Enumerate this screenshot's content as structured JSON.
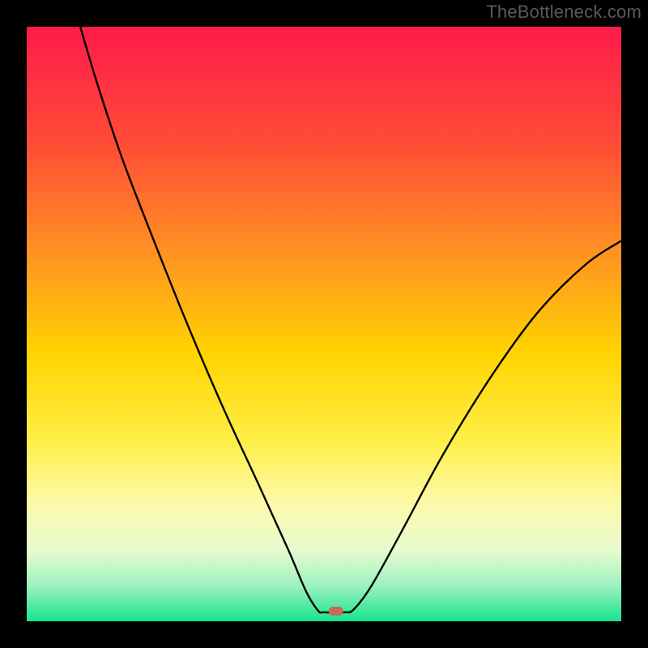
{
  "watermark": "TheBottleneck.com",
  "chart_data": {
    "type": "line",
    "title": "",
    "xlabel": "",
    "ylabel": "",
    "xlim": [
      0,
      100
    ],
    "ylim": [
      0,
      100
    ],
    "background_gradient": {
      "stops": [
        {
          "offset": 0,
          "color": "#ff1a4b"
        },
        {
          "offset": 20,
          "color": "#ff4d36"
        },
        {
          "offset": 40,
          "color": "#ff9a1f"
        },
        {
          "offset": 55,
          "color": "#ffd400"
        },
        {
          "offset": 70,
          "color": "#ffef4a"
        },
        {
          "offset": 80,
          "color": "#fdf9a8"
        },
        {
          "offset": 88,
          "color": "#e8fbcf"
        },
        {
          "offset": 94,
          "color": "#9df2c0"
        },
        {
          "offset": 100,
          "color": "#17e38e"
        }
      ]
    },
    "series": [
      {
        "name": "bottleneck-curve",
        "color": "#000000",
        "points": [
          {
            "x": 9.0,
            "y": 100.0
          },
          {
            "x": 12.0,
            "y": 90.0
          },
          {
            "x": 16.0,
            "y": 78.0
          },
          {
            "x": 21.0,
            "y": 65.0
          },
          {
            "x": 27.0,
            "y": 50.0
          },
          {
            "x": 33.0,
            "y": 36.0
          },
          {
            "x": 39.0,
            "y": 23.0
          },
          {
            "x": 44.0,
            "y": 12.0
          },
          {
            "x": 47.0,
            "y": 5.0
          },
          {
            "x": 49.0,
            "y": 1.8
          },
          {
            "x": 50.0,
            "y": 1.5
          },
          {
            "x": 53.5,
            "y": 1.5
          },
          {
            "x": 55.0,
            "y": 2.0
          },
          {
            "x": 58.0,
            "y": 6.0
          },
          {
            "x": 63.0,
            "y": 15.0
          },
          {
            "x": 70.0,
            "y": 28.0
          },
          {
            "x": 78.0,
            "y": 41.0
          },
          {
            "x": 86.0,
            "y": 52.0
          },
          {
            "x": 94.0,
            "y": 60.0
          },
          {
            "x": 100.0,
            "y": 64.0
          }
        ]
      }
    ],
    "marker": {
      "name": "optimal-point",
      "x": 52.0,
      "y": 1.7,
      "color": "#c96a57"
    }
  }
}
